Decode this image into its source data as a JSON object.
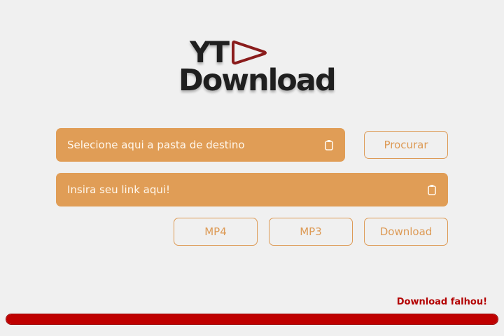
{
  "logo": {
    "line1": "YT",
    "line2": "Download",
    "play_icon": "play-triangle-icon",
    "accent": "#8a1c1c"
  },
  "folder": {
    "placeholder": "Selecione aqui a pasta de destino",
    "icon": "clipboard-icon"
  },
  "browse": {
    "label": "Procurar"
  },
  "link": {
    "placeholder": "Insira seu link aqui!",
    "icon": "clipboard-icon"
  },
  "actions": {
    "mp4": "MP4",
    "mp3": "MP3",
    "download": "Download"
  },
  "status": {
    "message": "Download falhou!",
    "color": "#b30000"
  },
  "progress": {
    "value": 1.0,
    "color": "#bf0000"
  },
  "colors": {
    "field": "#e09d56",
    "button_border": "#dd9a55",
    "background": "#f0f0f0"
  }
}
